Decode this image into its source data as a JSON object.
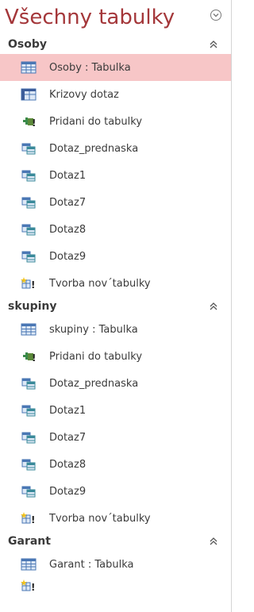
{
  "pane": {
    "title": "Všechny tabulky",
    "menu_icon": "chevron-down-circle-icon"
  },
  "groups": [
    {
      "name": "Osoby",
      "items": [
        {
          "label": "Osoby : Tabulka",
          "icon": "table-icon",
          "selected": true
        },
        {
          "label": "Krizovy dotaz",
          "icon": "crosstab-query-icon"
        },
        {
          "label": "Pridani do tabulky",
          "icon": "append-query-icon"
        },
        {
          "label": "Dotaz_prednaska",
          "icon": "select-query-icon"
        },
        {
          "label": "Dotaz1",
          "icon": "select-query-icon"
        },
        {
          "label": "Dotaz7",
          "icon": "select-query-icon"
        },
        {
          "label": "Dotaz8",
          "icon": "select-query-icon"
        },
        {
          "label": "Dotaz9",
          "icon": "select-query-icon"
        },
        {
          "label": "Tvorba nov´tabulky",
          "icon": "make-table-query-icon"
        }
      ]
    },
    {
      "name": "skupiny",
      "items": [
        {
          "label": "skupiny : Tabulka",
          "icon": "table-icon"
        },
        {
          "label": "Pridani do tabulky",
          "icon": "append-query-icon"
        },
        {
          "label": "Dotaz_prednaska",
          "icon": "select-query-icon"
        },
        {
          "label": "Dotaz1",
          "icon": "select-query-icon"
        },
        {
          "label": "Dotaz7",
          "icon": "select-query-icon"
        },
        {
          "label": "Dotaz8",
          "icon": "select-query-icon"
        },
        {
          "label": "Dotaz9",
          "icon": "select-query-icon"
        },
        {
          "label": "Tvorba nov´tabulky",
          "icon": "make-table-query-icon"
        }
      ]
    },
    {
      "name": "Garant",
      "items": [
        {
          "label": "Garant : Tabulka",
          "icon": "table-icon"
        }
      ]
    }
  ],
  "colors": {
    "title": "#a4373a",
    "selected_bg": "#f7c6c7",
    "table_icon_blue": "#4a77b4",
    "query_green": "#3a8a4a"
  }
}
